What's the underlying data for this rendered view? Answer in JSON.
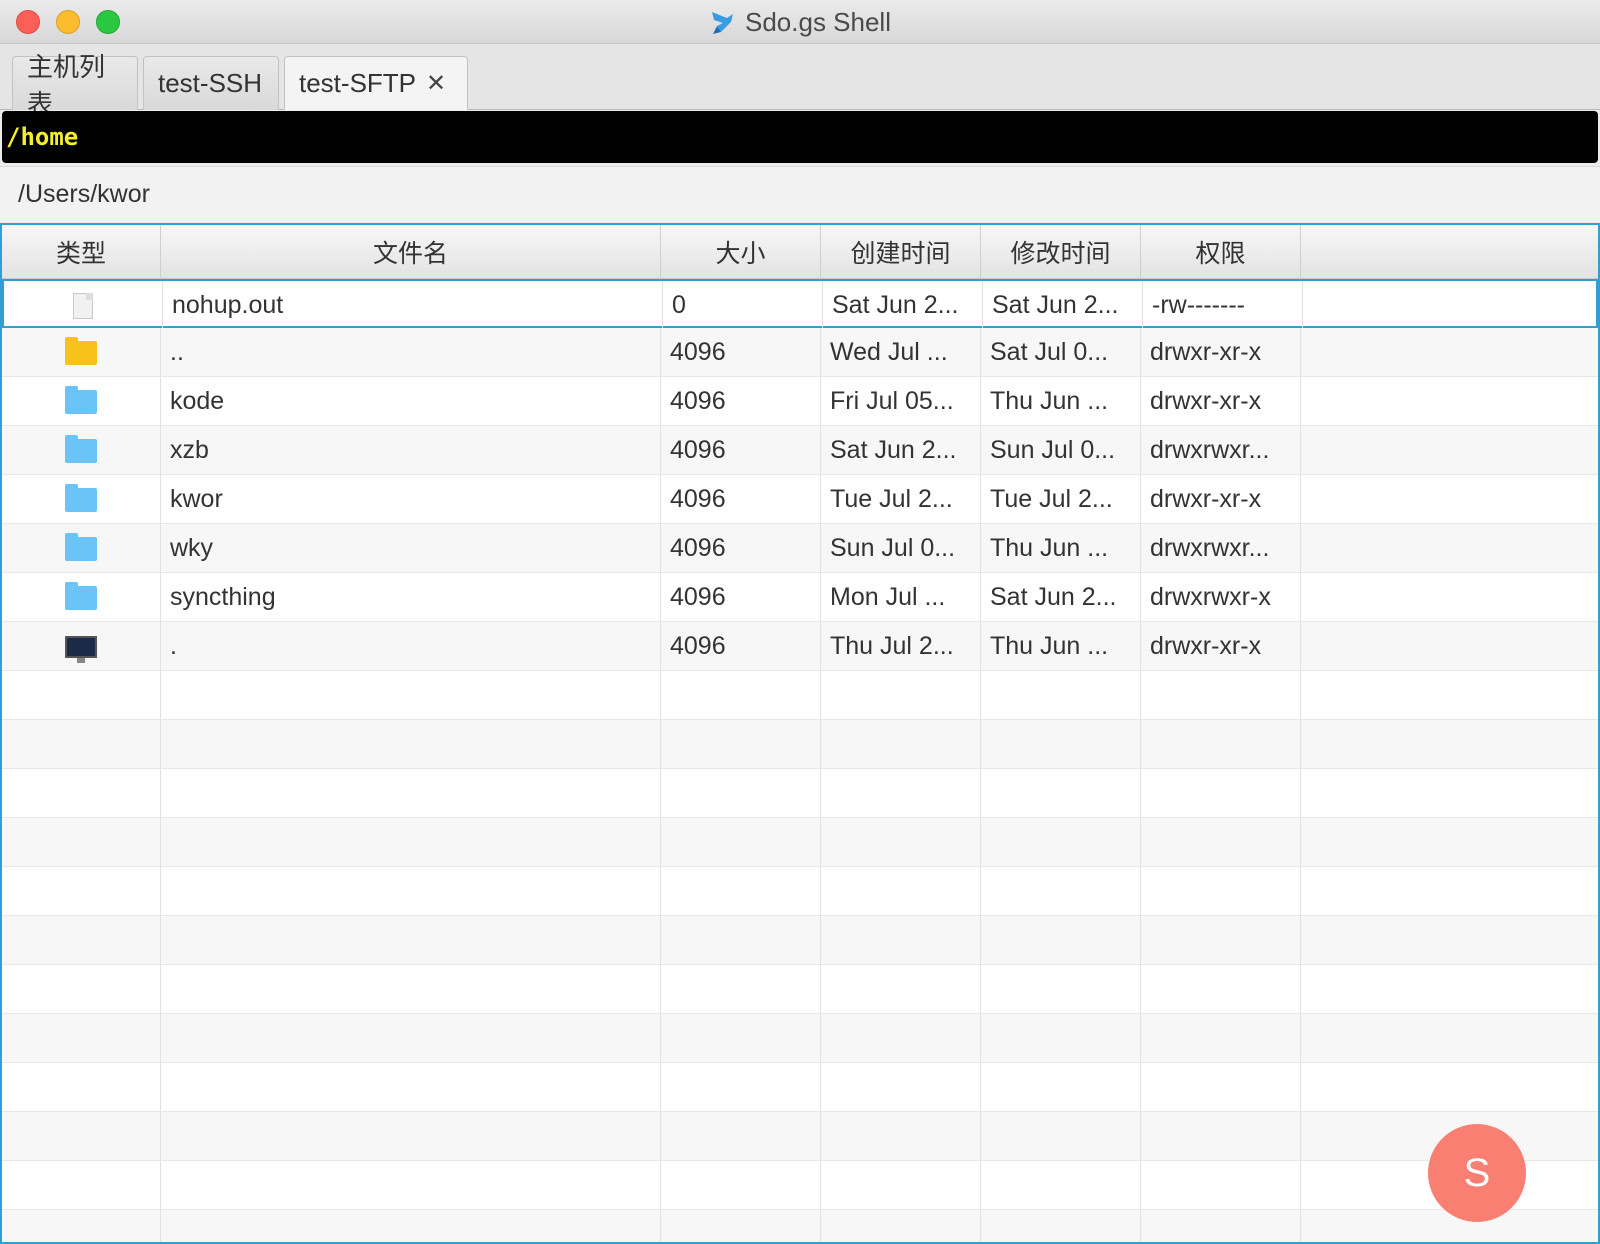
{
  "window": {
    "title": "Sdo.gs Shell",
    "app_icon": "bird-logo-icon"
  },
  "tabs": [
    {
      "label": "主机列表"
    },
    {
      "label": "test-SSH"
    },
    {
      "label": "test-SFTP",
      "close": "✕"
    }
  ],
  "remote_path": "/home",
  "local_path": "/Users/kwor",
  "table": {
    "columns": [
      "类型",
      "文件名",
      "大小",
      "创建时间",
      "修改时间",
      "权限",
      ""
    ],
    "rows": [
      {
        "type_icon": "file-icon",
        "name": "nohup.out",
        "size": "0",
        "created": "Sat Jun 2...",
        "modified": "Sat Jun 2...",
        "perm": "-rw-------"
      },
      {
        "type_icon": "parent-folder-icon",
        "name": "..",
        "size": "4096",
        "created": "Wed Jul ...",
        "modified": "Sat Jul 0...",
        "perm": "drwxr-xr-x"
      },
      {
        "type_icon": "folder-icon",
        "name": "kode",
        "size": "4096",
        "created": "Fri Jul 05...",
        "modified": "Thu Jun ...",
        "perm": "drwxr-xr-x"
      },
      {
        "type_icon": "folder-icon",
        "name": "xzb",
        "size": "4096",
        "created": "Sat Jun 2...",
        "modified": "Sun Jul 0...",
        "perm": "drwxrwxr..."
      },
      {
        "type_icon": "folder-icon",
        "name": "kwor",
        "size": "4096",
        "created": "Tue Jul 2...",
        "modified": "Tue Jul 2...",
        "perm": "drwxr-xr-x"
      },
      {
        "type_icon": "folder-icon",
        "name": "wky",
        "size": "4096",
        "created": "Sun Jul 0...",
        "modified": "Thu Jun ...",
        "perm": "drwxrwxr..."
      },
      {
        "type_icon": "folder-icon",
        "name": "syncthing",
        "size": "4096",
        "created": "Mon Jul ...",
        "modified": "Sat Jun 2...",
        "perm": "drwxrwxr-x"
      },
      {
        "type_icon": "computer-icon",
        "name": ".",
        "size": "4096",
        "created": "Thu Jul 2...",
        "modified": "Thu Jun ...",
        "perm": "drwxr-xr-x"
      }
    ]
  },
  "fab": {
    "label": "S"
  },
  "colors": {
    "accent": "#2f9fd6",
    "path_text": "#f5ef2a",
    "fab": "#f97f72"
  }
}
